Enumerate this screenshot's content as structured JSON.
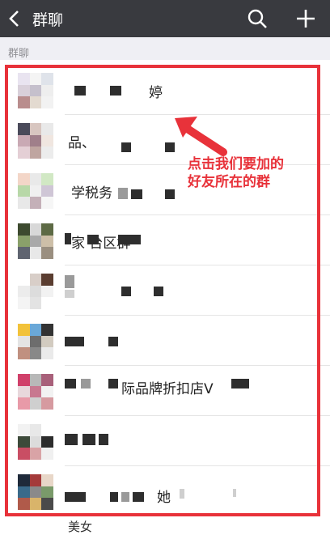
{
  "topbar": {
    "title": "群聊",
    "back_icon": "back-chevron-icon",
    "search_icon": "search-icon",
    "add_icon": "plus-icon"
  },
  "section": {
    "label": "群聊"
  },
  "groups": [
    {
      "name": "婷"
    },
    {
      "name": "品、"
    },
    {
      "name": "学税务"
    },
    {
      "name": "家        台区群"
    },
    {
      "name": ""
    },
    {
      "name": ""
    },
    {
      "name": "际品牌折扣店V"
    },
    {
      "name": ""
    },
    {
      "name": "她"
    }
  ],
  "annotation": {
    "line1": "点击我们要加的",
    "line2": "好友所在的群",
    "color": "#e8323a"
  },
  "bottom_peek": "美女"
}
